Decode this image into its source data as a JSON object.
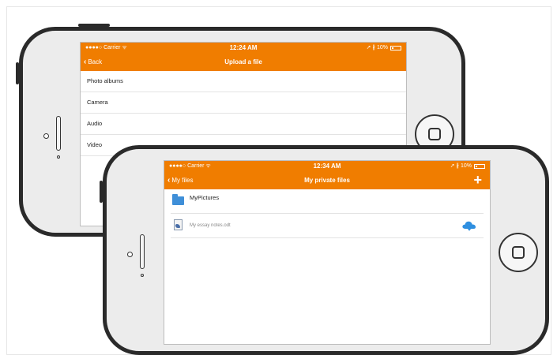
{
  "colors": {
    "accent": "#f07d00",
    "folder": "#3f8fd8",
    "cloud": "#2f8fe0"
  },
  "back_phone": {
    "status": {
      "carrier": "●●●●○ Carrier ᯤ",
      "time": "12:24 AM",
      "battery": "➚ ∦ 10%"
    },
    "nav": {
      "back_label": "Back",
      "title": "Upload a file"
    },
    "rows": [
      {
        "label": "Photo albums"
      },
      {
        "label": "Camera"
      },
      {
        "label": "Audio"
      },
      {
        "label": "Video"
      }
    ]
  },
  "front_phone": {
    "status": {
      "carrier": "●●●●○ Carrier ᯤ",
      "time": "12:34 AM",
      "battery": "➚ ∦ 10%"
    },
    "nav": {
      "back_label": "My files",
      "title": "My private files",
      "add_label": "+"
    },
    "files": [
      {
        "name": "MyPictures",
        "icon": "folder-icon"
      },
      {
        "name": "My essay notes.odt",
        "icon": "document-icon",
        "status_icon": "cloud-download-icon"
      }
    ]
  }
}
